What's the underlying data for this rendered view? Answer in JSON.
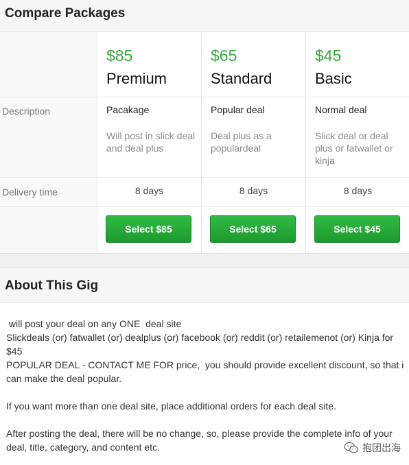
{
  "compare": {
    "title": "Compare Packages",
    "row_labels": {
      "description": "Description",
      "delivery": "Delivery time"
    },
    "packages": [
      {
        "price": "$85",
        "name": "Premium",
        "title": "Pacakage",
        "desc": "Will post in slick deal and deal plus",
        "delivery": "8 days",
        "button": "Select $85"
      },
      {
        "price": "$65",
        "name": "Standard",
        "title": "Popular deal",
        "desc": "Deal plus as a populardeal",
        "delivery": "8 days",
        "button": "Select $65"
      },
      {
        "price": "$45",
        "name": "Basic",
        "title": "Normal deal",
        "desc": "Slick deal or deal plus or fatwallet or kinja",
        "delivery": "8 days",
        "button": "Select $45"
      }
    ]
  },
  "about": {
    "title": "About This Gig",
    "lines": [
      " will post your deal on any ONE  deal site",
      "Slickdeals (or) fatwallet (or) dealplus (or) facebook (or) reddit (or) retailemenot (or) Kinja for $45",
      "POPULAR DEAL - CONTACT ME FOR price,  you should provide excellent discount, so that i can make the deal popular.",
      "If you want more than one deal site, place additional orders for each deal site.",
      "After posting the deal, there will be no change, so, please provide the complete info of your deal, title, category, and content etc."
    ]
  },
  "watermark": {
    "text": "抱团出海",
    "icon": "wechat-icon"
  },
  "colors": {
    "price": "#3aa83e",
    "button": "#22aa38",
    "header_bg": "#f6f6f6"
  }
}
